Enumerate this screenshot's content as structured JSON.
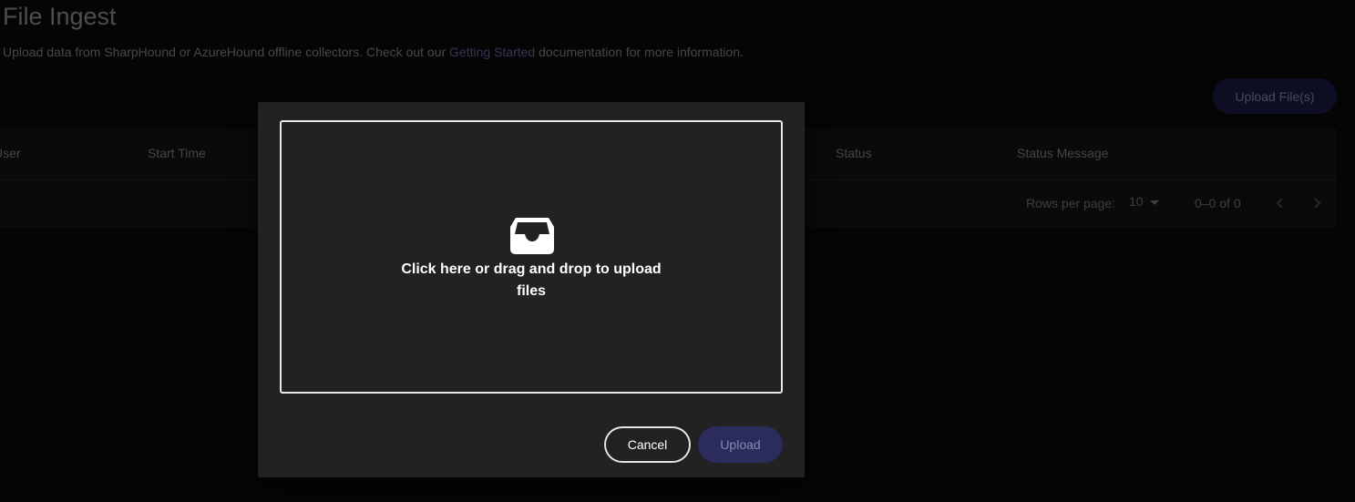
{
  "page": {
    "title": "File Ingest",
    "description_prefix": "Upload data from SharpHound or AzureHound offline collectors. Check out our ",
    "description_link": "Getting Started",
    "description_suffix": " documentation for more information.",
    "upload_files_label": "Upload File(s)"
  },
  "table": {
    "columns": [
      "User",
      "Start Time",
      "Status",
      "Status Message"
    ],
    "rows": [],
    "pagination": {
      "rows_per_page_label": "Rows per page:",
      "rows_per_page_value": "10",
      "range_label": "0–0 of 0"
    }
  },
  "dialog": {
    "dropzone_text": "Click here or drag and drop to upload files",
    "dropzone_icon": "inbox-icon",
    "cancel_label": "Cancel",
    "upload_label": "Upload"
  },
  "colors": {
    "background": "#0b0b0b",
    "dialog": "#222222",
    "accent": "#1b1c48",
    "link": "#6b6fa8"
  }
}
